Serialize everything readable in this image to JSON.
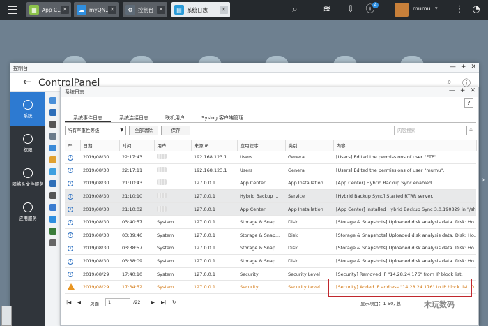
{
  "topbar": {
    "tabs": [
      {
        "label": "App C...",
        "icon": "app-center-icon",
        "color": "#8cc24a"
      },
      {
        "label": "myQN...",
        "icon": "myqnapcloud-icon",
        "color": "#2f8fe0"
      },
      {
        "label": "控制台",
        "icon": "gear-icon",
        "color": "#5e6a76"
      },
      {
        "label": "系统日志",
        "icon": "system-log-icon",
        "color": "#2a9bd8"
      }
    ],
    "notification_count": "4",
    "user": "mumu"
  },
  "control_panel": {
    "window_title": "控制台",
    "title": "ControlPanel",
    "sidebar": [
      {
        "label": "系统"
      },
      {
        "label": "权限"
      },
      {
        "label": "网络＆文件服务"
      },
      {
        "label": "应用服务"
      }
    ]
  },
  "log_window": {
    "title": "系统日志",
    "help": "?",
    "tabs": [
      "系统事件日志",
      "系统连接日志",
      "联机用户",
      "Syslog 客户端管理"
    ],
    "severity_filter": "所有严重性等级",
    "clear_all": "全部清除",
    "save": "保存",
    "search_placeholder": "内容搜索",
    "columns": [
      "严...",
      "日期",
      "时间",
      "用户",
      "来源 IP",
      "应用程序",
      "类别",
      "内容"
    ],
    "rows": [
      {
        "type": "info",
        "date": "2019/08/30",
        "time": "22:17:43",
        "user": "",
        "ip": "192.168.123.1",
        "app": "Users",
        "category": "General",
        "content": "[Users] Edited the permissions of user \"FTP\"."
      },
      {
        "type": "info",
        "date": "2019/08/30",
        "time": "22:17:11",
        "user": "",
        "ip": "192.168.123.1",
        "app": "Users",
        "category": "General",
        "content": "[Users] Edited the permissions of user \"mumu\"."
      },
      {
        "type": "info",
        "date": "2019/08/30",
        "time": "21:10:43",
        "user": "",
        "ip": "127.0.0.1",
        "app": "App Center",
        "category": "App Installation",
        "content": "[App Center] Hybrid Backup Sync enabled."
      },
      {
        "type": "info",
        "date": "2019/08/30",
        "time": "21:10:10",
        "user": "",
        "ip": "127.0.0.1",
        "app": "Hybrid Backup ...",
        "category": "Service",
        "content": "[Hybrid Backup Sync] Started RTRR server."
      },
      {
        "type": "info",
        "date": "2019/08/30",
        "time": "21:10:02",
        "user": "",
        "ip": "127.0.0.1",
        "app": "App Center",
        "category": "App Installation",
        "content": "[App Center] Installed Hybrid Backup Sync 3.0.190829 in \"/sh..."
      },
      {
        "type": "info",
        "date": "2019/08/30",
        "time": "03:40:57",
        "user": "System",
        "ip": "127.0.0.1",
        "app": "Storage & Snap...",
        "category": "Disk",
        "content": "[Storage & Snapshots] Uploaded disk analysis data. Disk: Ho..."
      },
      {
        "type": "info",
        "date": "2019/08/30",
        "time": "03:39:46",
        "user": "System",
        "ip": "127.0.0.1",
        "app": "Storage & Snap...",
        "category": "Disk",
        "content": "[Storage & Snapshots] Uploaded disk analysis data. Disk: Ho..."
      },
      {
        "type": "info",
        "date": "2019/08/30",
        "time": "03:38:57",
        "user": "System",
        "ip": "127.0.0.1",
        "app": "Storage & Snap...",
        "category": "Disk",
        "content": "[Storage & Snapshots] Uploaded disk analysis data. Disk: Ho..."
      },
      {
        "type": "info",
        "date": "2019/08/30",
        "time": "03:38:09",
        "user": "System",
        "ip": "127.0.0.1",
        "app": "Storage & Snap...",
        "category": "Disk",
        "content": "[Storage & Snapshots] Uploaded disk analysis data. Disk: Ho..."
      },
      {
        "type": "info",
        "date": "2019/08/29",
        "time": "17:40:10",
        "user": "System",
        "ip": "127.0.0.1",
        "app": "Security",
        "category": "Security Level",
        "content": "[Security] Removed IP \"14.28.24.176\" from IP block list."
      },
      {
        "type": "warning",
        "date": "2019/08/29",
        "time": "17:34:52",
        "user": "System",
        "ip": "127.0.0.1",
        "app": "Security",
        "category": "Security Level",
        "content": "[Security] Added IP address \"14.28.24.176\" to IP block list. D..."
      }
    ],
    "pager": {
      "page_label": "页面",
      "current_page": "1",
      "total_pages": "/22",
      "display_label": "显示项目：1-50, 总"
    }
  },
  "watermark": "木玩数码"
}
